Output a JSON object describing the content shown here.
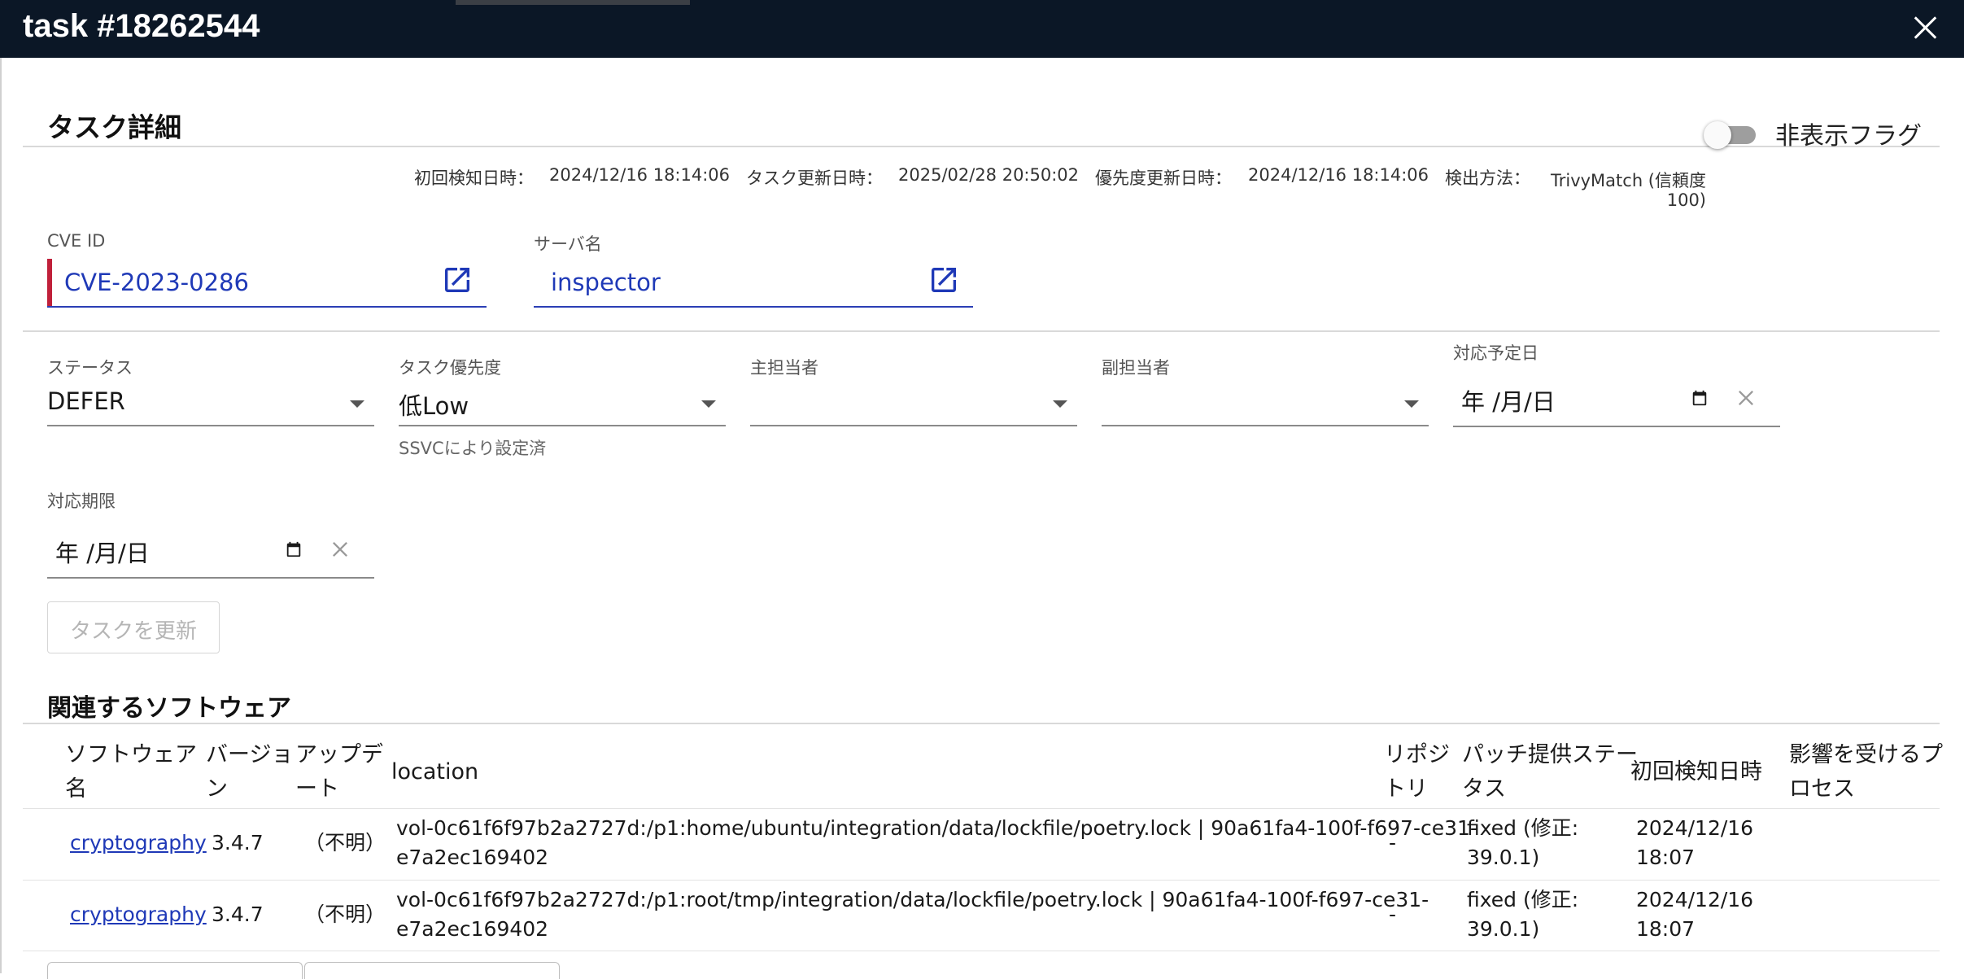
{
  "window": {
    "title": "task #18262544"
  },
  "details": {
    "section_title": "タスク詳細",
    "hide_flag_label": "非表示フラグ",
    "meta": {
      "first_detected_label": "初回検知日時：",
      "first_detected_value": "2024/12/16 18:14:06",
      "task_updated_label": "タスク更新日時：",
      "task_updated_value": "2025/02/28 20:50:02",
      "priority_updated_label": "優先度更新日時：",
      "priority_updated_value": "2024/12/16 18:14:06",
      "detection_method_label": "検出方法：",
      "detection_method_line1": "TrivyMatch (信頼度",
      "detection_method_line2": "100)"
    },
    "cve": {
      "label": "CVE ID",
      "value": "CVE-2023-0286"
    },
    "server": {
      "label": "サーバ名",
      "value": "inspector"
    },
    "status": {
      "label": "ステータス",
      "value": "DEFER"
    },
    "priority": {
      "label": "タスク優先度",
      "value": "低Low",
      "helper": "SSVCにより設定済"
    },
    "assignee": {
      "label": "主担当者",
      "value": ""
    },
    "sub_assignee": {
      "label": "副担当者",
      "value": ""
    },
    "planned_date": {
      "label": "対応予定日",
      "value": "年 /月/日"
    },
    "deadline": {
      "label": "対応期限",
      "value": "年 /月/日"
    },
    "update_button": "タスクを更新"
  },
  "software": {
    "section_title": "関連するソフトウェア",
    "headers": {
      "name_l1": "ソフトウェア",
      "name_l2": "名",
      "version_l1": "バージョ",
      "version_l2": "ン",
      "update_l1": "アップデ",
      "update_l2": "ート",
      "location": "location",
      "repo_l1": "リポジ",
      "repo_l2": "トリ",
      "patch_l1": "パッチ提供ステー",
      "patch_l2": "タス",
      "first": "初回検知日時",
      "proc_l1": "影響を受けるプ",
      "proc_l2": "ロセス"
    },
    "rows": [
      {
        "name": "cryptography",
        "version": "3.4.7",
        "update": "（不明）",
        "location_l1": "vol-0c61f6f97b2a2727d:/p1:home/ubuntu/integration/data/lockfile/poetry.lock | 90a61fa4-100f-f697-ce31-",
        "location_l2": "e7a2ec169402",
        "repo": "-",
        "patch_l1": "fixed (修正:",
        "patch_l2": "39.0.1)",
        "first_l1": "2024/12/16",
        "first_l2": "18:07",
        "process": ""
      },
      {
        "name": "cryptography",
        "version": "3.4.7",
        "update": "（不明）",
        "location_l1": "vol-0c61f6f97b2a2727d:/p1:root/tmp/integration/data/lockfile/poetry.lock | 90a61fa4-100f-f697-ce31-",
        "location_l2": "e7a2ec169402",
        "repo": "-",
        "patch_l1": "fixed (修正:",
        "patch_l2": "39.0.1)",
        "first_l1": "2024/12/16",
        "first_l2": "18:07",
        "process": ""
      }
    ]
  }
}
